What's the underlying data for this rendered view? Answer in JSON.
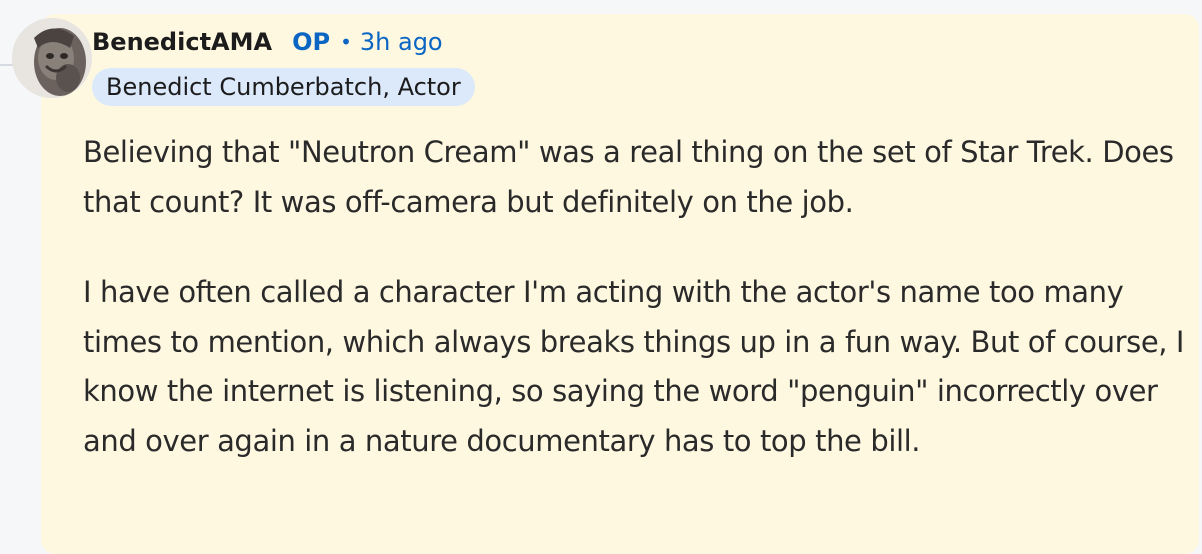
{
  "comment": {
    "author": "BenedictAMA",
    "op_label": "OP",
    "separator": "•",
    "timestamp": "3h ago",
    "flair": "Benedict Cumberbatch, Actor",
    "paragraphs": [
      "Believing that \"Neutron Cream\" was a real thing on the set of Star Trek. Does that count? It was off-camera but definitely on the job.",
      "I have often called a character I'm acting with the actor's name too many times to mention, which always breaks things up in a fun way. But of course, I know the internet is listening, so saying the word \"penguin\" incorrectly over and over again in a nature documentary has to top the bill."
    ]
  },
  "colors": {
    "card_background": "#fff8e1",
    "accent": "#0a66c2",
    "flair_background": "#dbe9fb",
    "text": "#1c1c1c"
  }
}
